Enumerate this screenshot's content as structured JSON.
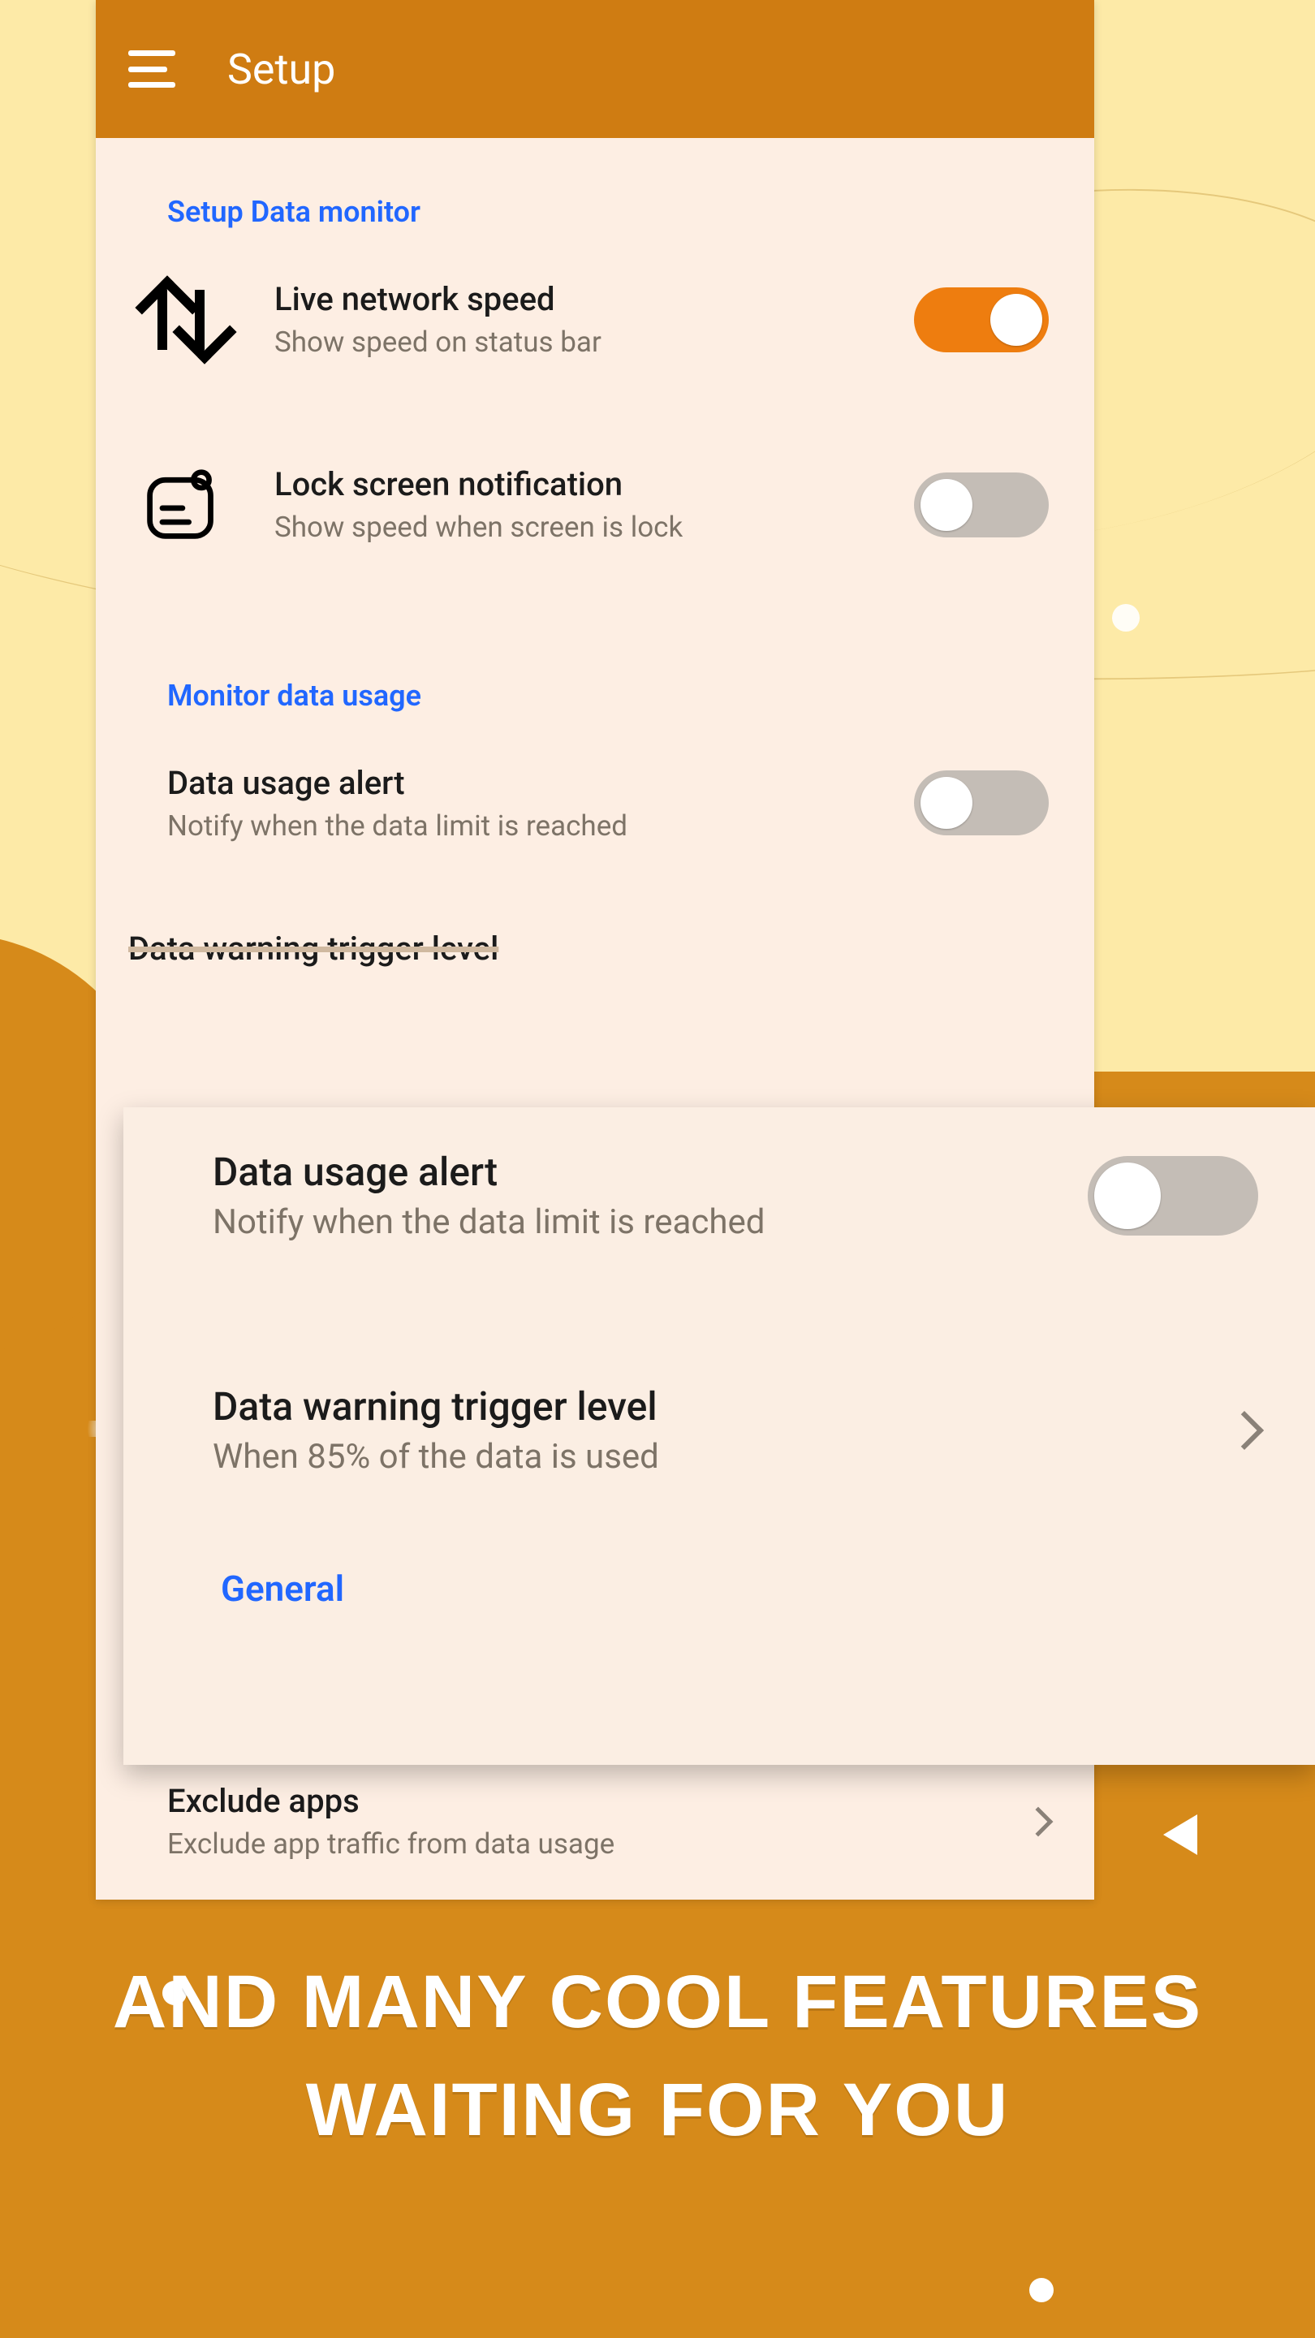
{
  "appbar": {
    "title": "Setup"
  },
  "sections": {
    "setup_data_monitor": "Setup Data monitor",
    "monitor_data_usage": "Monitor data usage",
    "general": "General"
  },
  "rows": {
    "live_speed": {
      "title": "Live network speed",
      "sub": "Show speed on status bar",
      "on": true
    },
    "lock_screen": {
      "title": "Lock screen notification",
      "sub": "Show speed when screen is lock",
      "on": false
    },
    "data_alert": {
      "title": "Data usage alert",
      "sub": "Notify when the data limit is reached",
      "on": false
    },
    "cut_row": {
      "title": "Data warning trigger level"
    },
    "exclude_apps": {
      "title": "Exclude apps",
      "sub": "Exclude app traffic from data usage"
    }
  },
  "front": {
    "data_alert": {
      "title": "Data usage alert",
      "sub": "Notify when the data limit is reached",
      "on": false
    },
    "trigger": {
      "title": "Data warning trigger level",
      "sub": "When 85% of the data is used"
    }
  },
  "promo": "And many cool features waiting for you"
}
